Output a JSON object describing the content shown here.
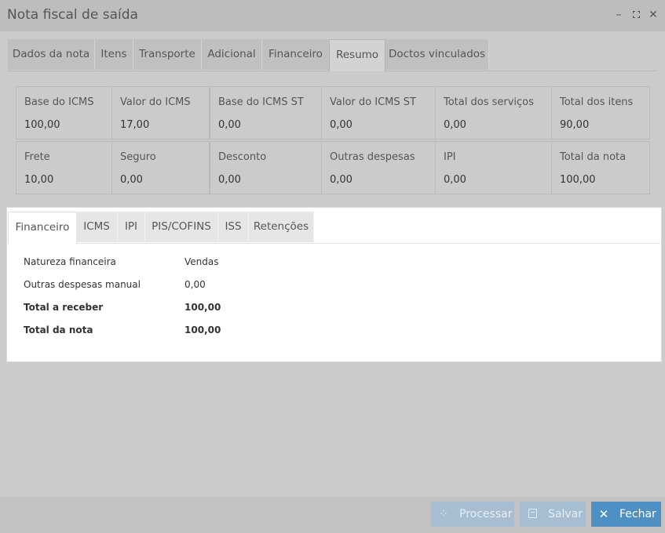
{
  "window": {
    "title": "Nota fiscal de saída",
    "minimize_glyph": "–",
    "close_glyph": "✕"
  },
  "main_tabs": [
    {
      "label": "Dados da nota",
      "active": false
    },
    {
      "label": "Itens",
      "active": false
    },
    {
      "label": "Transporte",
      "active": false
    },
    {
      "label": "Adicional",
      "active": false
    },
    {
      "label": "Financeiro",
      "active": false
    },
    {
      "label": "Resumo",
      "active": true
    },
    {
      "label": "Doctos vinculados",
      "active": false
    }
  ],
  "summary": {
    "row1": [
      {
        "label": "Base do ICMS",
        "value": "100,00"
      },
      {
        "label": "Valor do ICMS",
        "value": "17,00"
      },
      {
        "label": "Base do ICMS ST",
        "value": "0,00"
      },
      {
        "label": "Valor do ICMS ST",
        "value": "0,00"
      },
      {
        "label": "Total dos serviços",
        "value": "0,00"
      },
      {
        "label": "Total dos itens",
        "value": "90,00"
      }
    ],
    "row2": [
      {
        "label": "Frete",
        "value": "10,00"
      },
      {
        "label": "Seguro",
        "value": "0,00"
      },
      {
        "label": "Desconto",
        "value": "0,00"
      },
      {
        "label": "Outras despesas",
        "value": "0,00"
      },
      {
        "label": "IPI",
        "value": "0,00"
      },
      {
        "label": "Total da nota",
        "value": "100,00"
      }
    ]
  },
  "sub_tabs": [
    {
      "label": "Financeiro",
      "active": true
    },
    {
      "label": "ICMS",
      "active": false
    },
    {
      "label": "IPI",
      "active": false
    },
    {
      "label": "PIS/COFINS",
      "active": false
    },
    {
      "label": "ISS",
      "active": false
    },
    {
      "label": "Retenções",
      "active": false
    }
  ],
  "financeiro": [
    {
      "label": "Natureza financeira",
      "value": "Vendas",
      "bold": false
    },
    {
      "label": "Outras despesas manual",
      "value": "0,00",
      "bold": false
    },
    {
      "label": "Total a receber",
      "value": "100,00",
      "bold": true
    },
    {
      "label": "Total da nota",
      "value": "100,00",
      "bold": true
    }
  ],
  "footer": {
    "processar": {
      "label": "Processar",
      "icon": "spinner-icon",
      "enabled": false
    },
    "salvar": {
      "label": "Salvar",
      "icon": "save-icon",
      "enabled": false
    },
    "fechar": {
      "label": "Fechar",
      "icon": "close-icon",
      "enabled": true
    }
  },
  "colors": {
    "primary_button": "#4e8fc4",
    "disabled_button": "#a6bdd2"
  }
}
